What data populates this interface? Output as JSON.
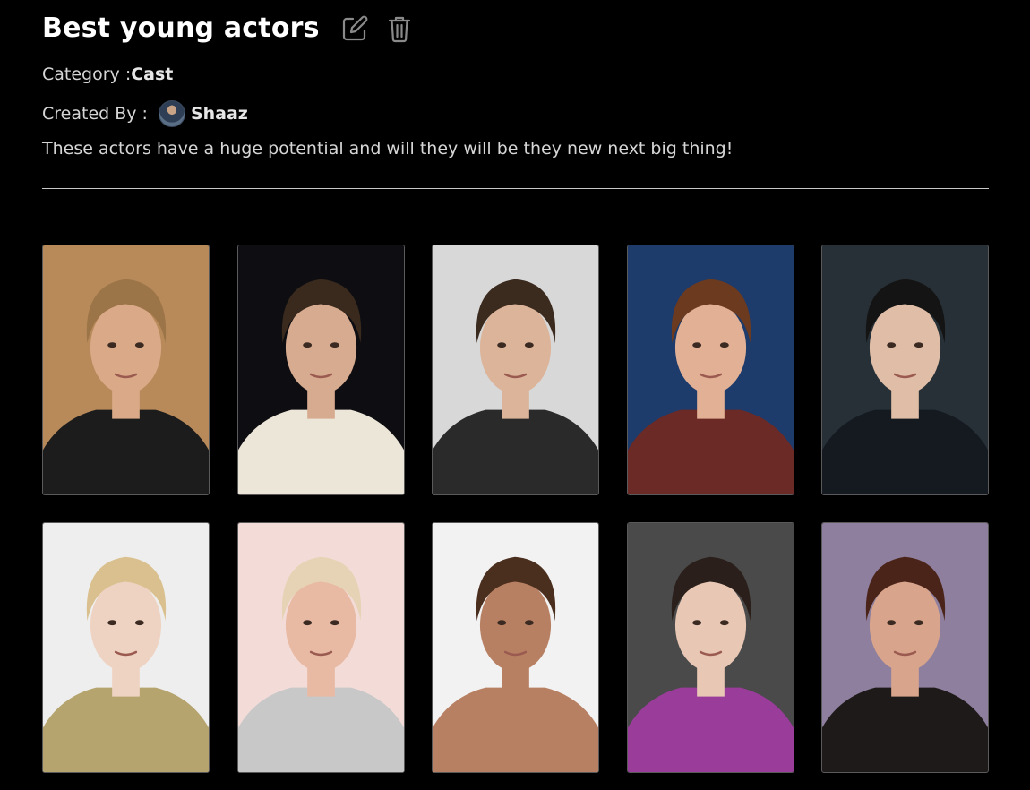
{
  "list": {
    "title": "Best young actors",
    "category_label": "Category : ",
    "category_value": "Cast",
    "created_by_label": "Created By : ",
    "creator_name": "Shaaz",
    "description": "These actors have a huge potential and will they will be they new next big thing!"
  },
  "icons": {
    "edit": "pencil-square-icon",
    "delete": "trash-icon"
  },
  "cards": [
    {
      "bg": "#b88a5a",
      "hair": "#9b7447",
      "skin": "#d9a988",
      "shirt": "#1c1c1c"
    },
    {
      "bg": "#0e0e12",
      "hair": "#3a2a1e",
      "skin": "#d7ab8f",
      "shirt": "#ece6d8"
    },
    {
      "bg": "#d8d8d8",
      "hair": "#3b2a1e",
      "skin": "#dcb49a",
      "shirt": "#2a2a2a"
    },
    {
      "bg": "#1d3b6b",
      "hair": "#6b3a1f",
      "skin": "#e2b195",
      "shirt": "#6b2a26"
    },
    {
      "bg": "#263036",
      "hair": "#141414",
      "skin": "#e0bda6",
      "shirt": "#141a20"
    },
    {
      "bg": "#eeeeee",
      "hair": "#d9c08e",
      "skin": "#efd3c2",
      "shirt": "#b6a46e"
    },
    {
      "bg": "#f3dcd8",
      "hair": "#e6d2b4",
      "skin": "#e8b9a3",
      "shirt": "#c8c8c8"
    },
    {
      "bg": "#f2f2f2",
      "hair": "#4a2e1e",
      "skin": "#b88063",
      "shirt": "#b88063"
    },
    {
      "bg": "#4a4a4a",
      "hair": "#2a1f1a",
      "skin": "#e8c7b4",
      "shirt": "#9a3c9a"
    },
    {
      "bg": "#8f7f9e",
      "hair": "#4a2418",
      "skin": "#d8a58c",
      "shirt": "#1e1a1a"
    }
  ]
}
